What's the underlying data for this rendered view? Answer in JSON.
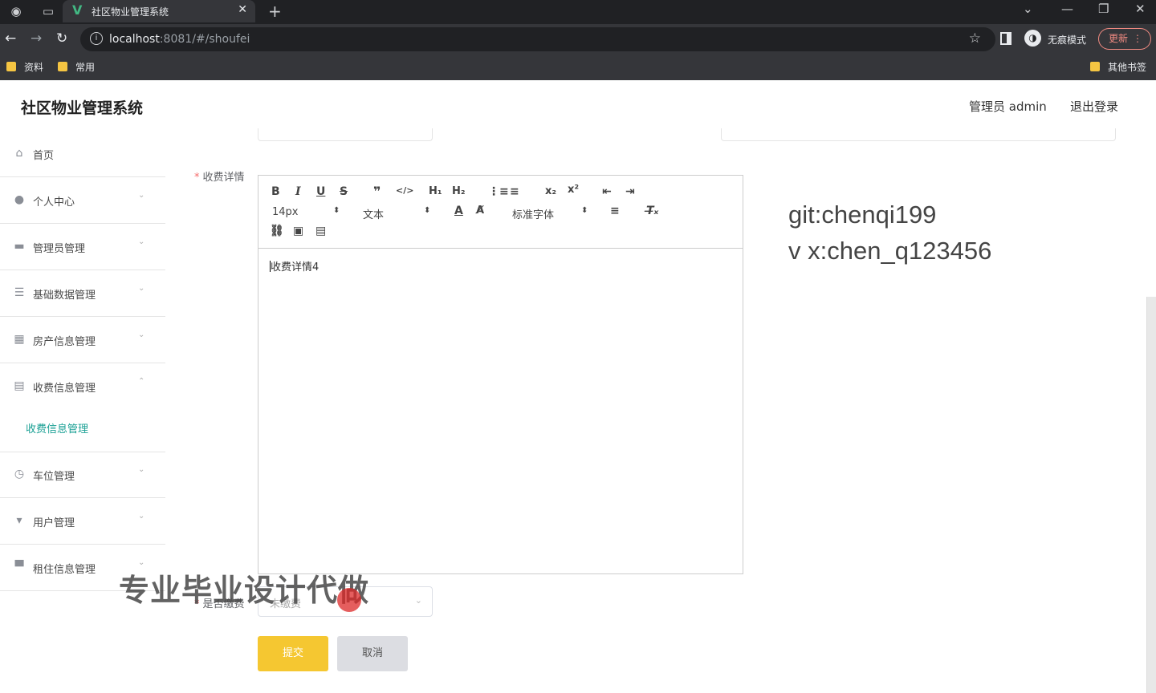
{
  "browser": {
    "tab_title": "社区物业管理系统",
    "tab_close": "✕",
    "new_tab": "+",
    "url_host": "localhost",
    "url_rest": ":8081/#/shoufei",
    "incognito_label": "无痕模式",
    "update_label": "更新",
    "bookmarks": [
      "资料",
      "常用"
    ],
    "other_bookmarks": "其他书签"
  },
  "app": {
    "title": "社区物业管理系统",
    "user": "管理员 admin",
    "logout": "退出登录"
  },
  "sidebar": {
    "items": [
      {
        "label": "首页",
        "icon": "home-icon"
      },
      {
        "label": "个人中心",
        "icon": "person-icon"
      },
      {
        "label": "管理员管理",
        "icon": "admin-icon"
      },
      {
        "label": "基础数据管理",
        "icon": "list-icon"
      },
      {
        "label": "房产信息管理",
        "icon": "grid-icon"
      },
      {
        "label": "收费信息管理",
        "icon": "clipboard-icon"
      },
      {
        "label": "车位管理",
        "icon": "clock-icon"
      },
      {
        "label": "用户管理",
        "icon": "user-mgmt-icon"
      },
      {
        "label": "租住信息管理",
        "icon": "monitor-icon"
      }
    ],
    "subitem": "收费信息管理"
  },
  "form": {
    "detail_label": "收费详情",
    "paid_label": "是否缴费",
    "toolbar": {
      "font_size": "14px",
      "header": "文本",
      "font_family": "标准字体"
    },
    "content": "收费详情4",
    "paid_value": "未缴费",
    "submit": "提交",
    "cancel": "取消"
  },
  "watermark": {
    "line1": "git:chenqi199",
    "line2": "v x:chen_q123456",
    "overlay": "专业毕业设计代做"
  }
}
